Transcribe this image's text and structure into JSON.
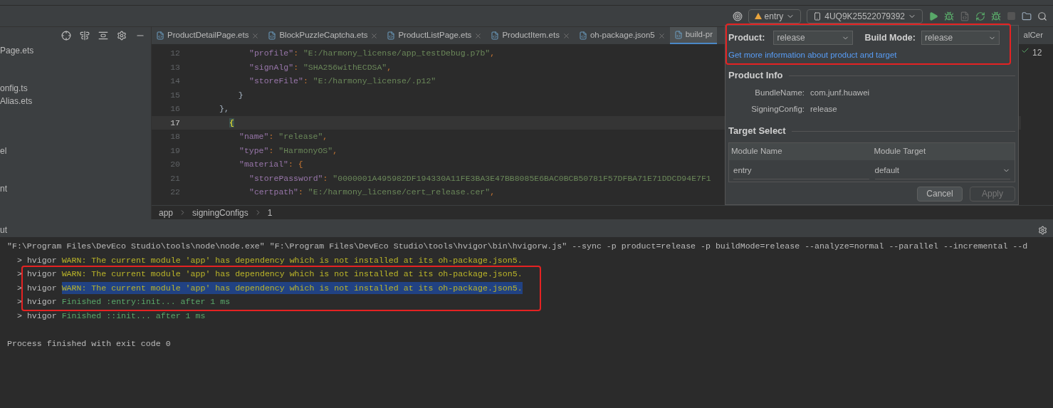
{
  "toolbar": {
    "module": "entry",
    "device": "4UQ9K25522079392"
  },
  "project_tree": {
    "items": [
      {
        "label": "Page.ets"
      },
      {
        "label": "onfig.ts"
      },
      {
        "label": "Alias.ets"
      },
      {
        "label": "el"
      },
      {
        "label": "nt"
      }
    ]
  },
  "editor_tabs": [
    {
      "label": "ProductDetailPage.ets",
      "selected": false
    },
    {
      "label": "BlockPuzzleCaptcha.ets",
      "selected": false
    },
    {
      "label": "ProductListPage.ets",
      "selected": false
    },
    {
      "label": "ProductItem.ets",
      "selected": false
    },
    {
      "label": "oh-package.json5",
      "selected": false
    },
    {
      "label": "build-pr",
      "selected": true
    }
  ],
  "editor_tab_overflow": "alCer",
  "problems_count": "12",
  "code_lines": [
    {
      "number": "12",
      "current": false,
      "code": [
        {
          "kind": "key",
          "text": "\"profile\""
        },
        {
          "kind": "punct",
          "text": ": "
        },
        {
          "kind": "string",
          "text": "\"E:/harmony_license/app_testDebug.p7b\""
        },
        {
          "kind": "punct",
          "text": ","
        }
      ]
    },
    {
      "number": "13",
      "current": false,
      "code": [
        {
          "kind": "key",
          "text": "\"signAlg\""
        },
        {
          "kind": "punct",
          "text": ": "
        },
        {
          "kind": "string",
          "text": "\"SHA256withECDSA\""
        },
        {
          "kind": "punct",
          "text": ","
        }
      ]
    },
    {
      "number": "14",
      "current": false,
      "code": [
        {
          "kind": "key",
          "text": "\"storeFile\""
        },
        {
          "kind": "punct",
          "text": ": "
        },
        {
          "kind": "string",
          "text": "\"E:/harmony_license/.p12\""
        }
      ]
    },
    {
      "number": "15",
      "current": false,
      "code": [
        {
          "kind": "brace",
          "text": "  }"
        }
      ]
    },
    {
      "number": "16",
      "current": false,
      "code": [
        {
          "kind": "brace",
          "text": "},"
        }
      ]
    },
    {
      "number": "17",
      "current": true,
      "code": [
        {
          "kind": "match",
          "text": "{"
        }
      ]
    },
    {
      "number": "18",
      "current": false,
      "code": [
        {
          "kind": "key",
          "text": "\"name\""
        },
        {
          "kind": "punct",
          "text": ": "
        },
        {
          "kind": "string",
          "text": "\"release\""
        },
        {
          "kind": "punct",
          "text": ","
        }
      ]
    },
    {
      "number": "19",
      "current": false,
      "code": [
        {
          "kind": "key",
          "text": "\"type\""
        },
        {
          "kind": "punct",
          "text": ": "
        },
        {
          "kind": "string",
          "text": "\"HarmonyOS\""
        },
        {
          "kind": "punct",
          "text": ","
        }
      ]
    },
    {
      "number": "20",
      "current": false,
      "code": [
        {
          "kind": "key",
          "text": "\"material\""
        },
        {
          "kind": "punct",
          "text": ": {"
        }
      ]
    },
    {
      "number": "21",
      "current": false,
      "code": [
        {
          "kind": "key",
          "text": "\"storePassword\""
        },
        {
          "kind": "punct",
          "text": ": "
        },
        {
          "kind": "string",
          "text": "\"0000001A495982DF194330A11FE3BA3E47BB8085E6BAC0BCB50781F57DFBA71E71DDCD94E7F1"
        }
      ]
    },
    {
      "number": "22",
      "current": false,
      "code": [
        {
          "kind": "key",
          "text": "\"certpath\""
        },
        {
          "kind": "punct",
          "text": ": "
        },
        {
          "kind": "string",
          "text": "\"E:/harmony_license/cert_release.cer\""
        },
        {
          "kind": "punct",
          "text": ","
        }
      ]
    }
  ],
  "breadcrumb": [
    "app",
    "signingConfigs",
    "1"
  ],
  "build_popup": {
    "product_label": "Product:",
    "product": "release",
    "build_mode_label": "Build Mode:",
    "build_mode": "release",
    "link": "Get more information about product and target",
    "product_info_title": "Product Info",
    "info": [
      {
        "label": "BundleName:",
        "value": "com.junf.huawei"
      },
      {
        "label": "SigningConfig:",
        "value": "release"
      }
    ],
    "target_select_title": "Target Select",
    "columns": [
      "Module Name",
      "Module Target"
    ],
    "rows": [
      {
        "module_name": "entry",
        "module_target": "default"
      }
    ],
    "buttons": [
      {
        "label": "Cancel",
        "disabled": false
      },
      {
        "label": "Apply",
        "disabled": true
      }
    ]
  },
  "run_panel": {
    "tab": "ut",
    "lines": [
      {
        "kind": "command",
        "text": "\"F:\\Program Files\\DevEco Studio\\tools\\node\\node.exe\" \"F:\\Program Files\\DevEco Studio\\tools\\hvigor\\bin\\hvigorw.js\" --sync -p product=release -p buildMode=release --analyze=normal --parallel --incremental --d",
        "selected": false
      },
      {
        "kind": "warn",
        "prefix": "> hvigor",
        "text": "WARN: The current module 'app' has dependency which is not installed at its oh-package.json5.",
        "selected": false
      },
      {
        "kind": "warn",
        "prefix": "> hvigor",
        "text": "WARN: The current module 'app' has dependency which is not installed at its oh-package.json5.",
        "selected": false
      },
      {
        "kind": "warn",
        "prefix": "> hvigor",
        "text": "WARN: The current module 'app' has dependency which is not installed at its oh-package.json5.",
        "selected": true
      },
      {
        "kind": "info",
        "prefix": "> hvigor",
        "text": "Finished :entry:init... after 1 ms",
        "selected": false
      },
      {
        "kind": "info",
        "prefix": "> hvigor",
        "text": "Finished ::init... after 1 ms",
        "selected": false
      },
      {
        "kind": "plain",
        "text": "Process finished with exit code 0",
        "selected": false
      }
    ]
  }
}
